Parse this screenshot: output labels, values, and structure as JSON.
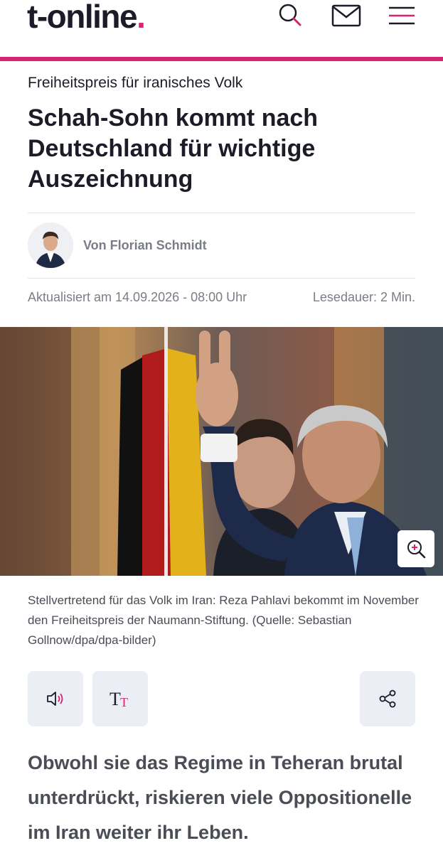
{
  "header": {
    "logo_text": "t-online",
    "logo_dot": ".",
    "icons": [
      "search-icon",
      "mail-icon",
      "menu-icon"
    ],
    "accent_color": "#d6246e"
  },
  "article": {
    "kicker": "Freiheitspreis für iranisches Volk",
    "headline": "Schah-Sohn kommt nach Deutschland für wichtige Auszeichnung",
    "author": "Von Florian Schmidt",
    "updated": "Aktualisiert am 14.09.2026 - 08:00 Uhr",
    "reading_time": "Lesedauer: 2 Min.",
    "caption": "Stellvertretend für das Volk im Iran: Reza Pahlavi bekommt im November den Freiheitspreis der Naumann-Stiftung. (Quelle: Sebastian Gollnow/dpa/dpa-bilder)",
    "lead": "Obwohl sie das Regime in Teheran brutal unterdrückt, riskieren viele Oppositionelle im Iran weiter ihr Leben."
  },
  "tools": {
    "icons": [
      "speaker-icon",
      "text-size-icon",
      "share-icon"
    ],
    "text_size_glyph": "Tт"
  },
  "colors": {
    "text": "#1c1c28",
    "muted": "#7a7d88",
    "tool_bg": "#eceef5"
  }
}
